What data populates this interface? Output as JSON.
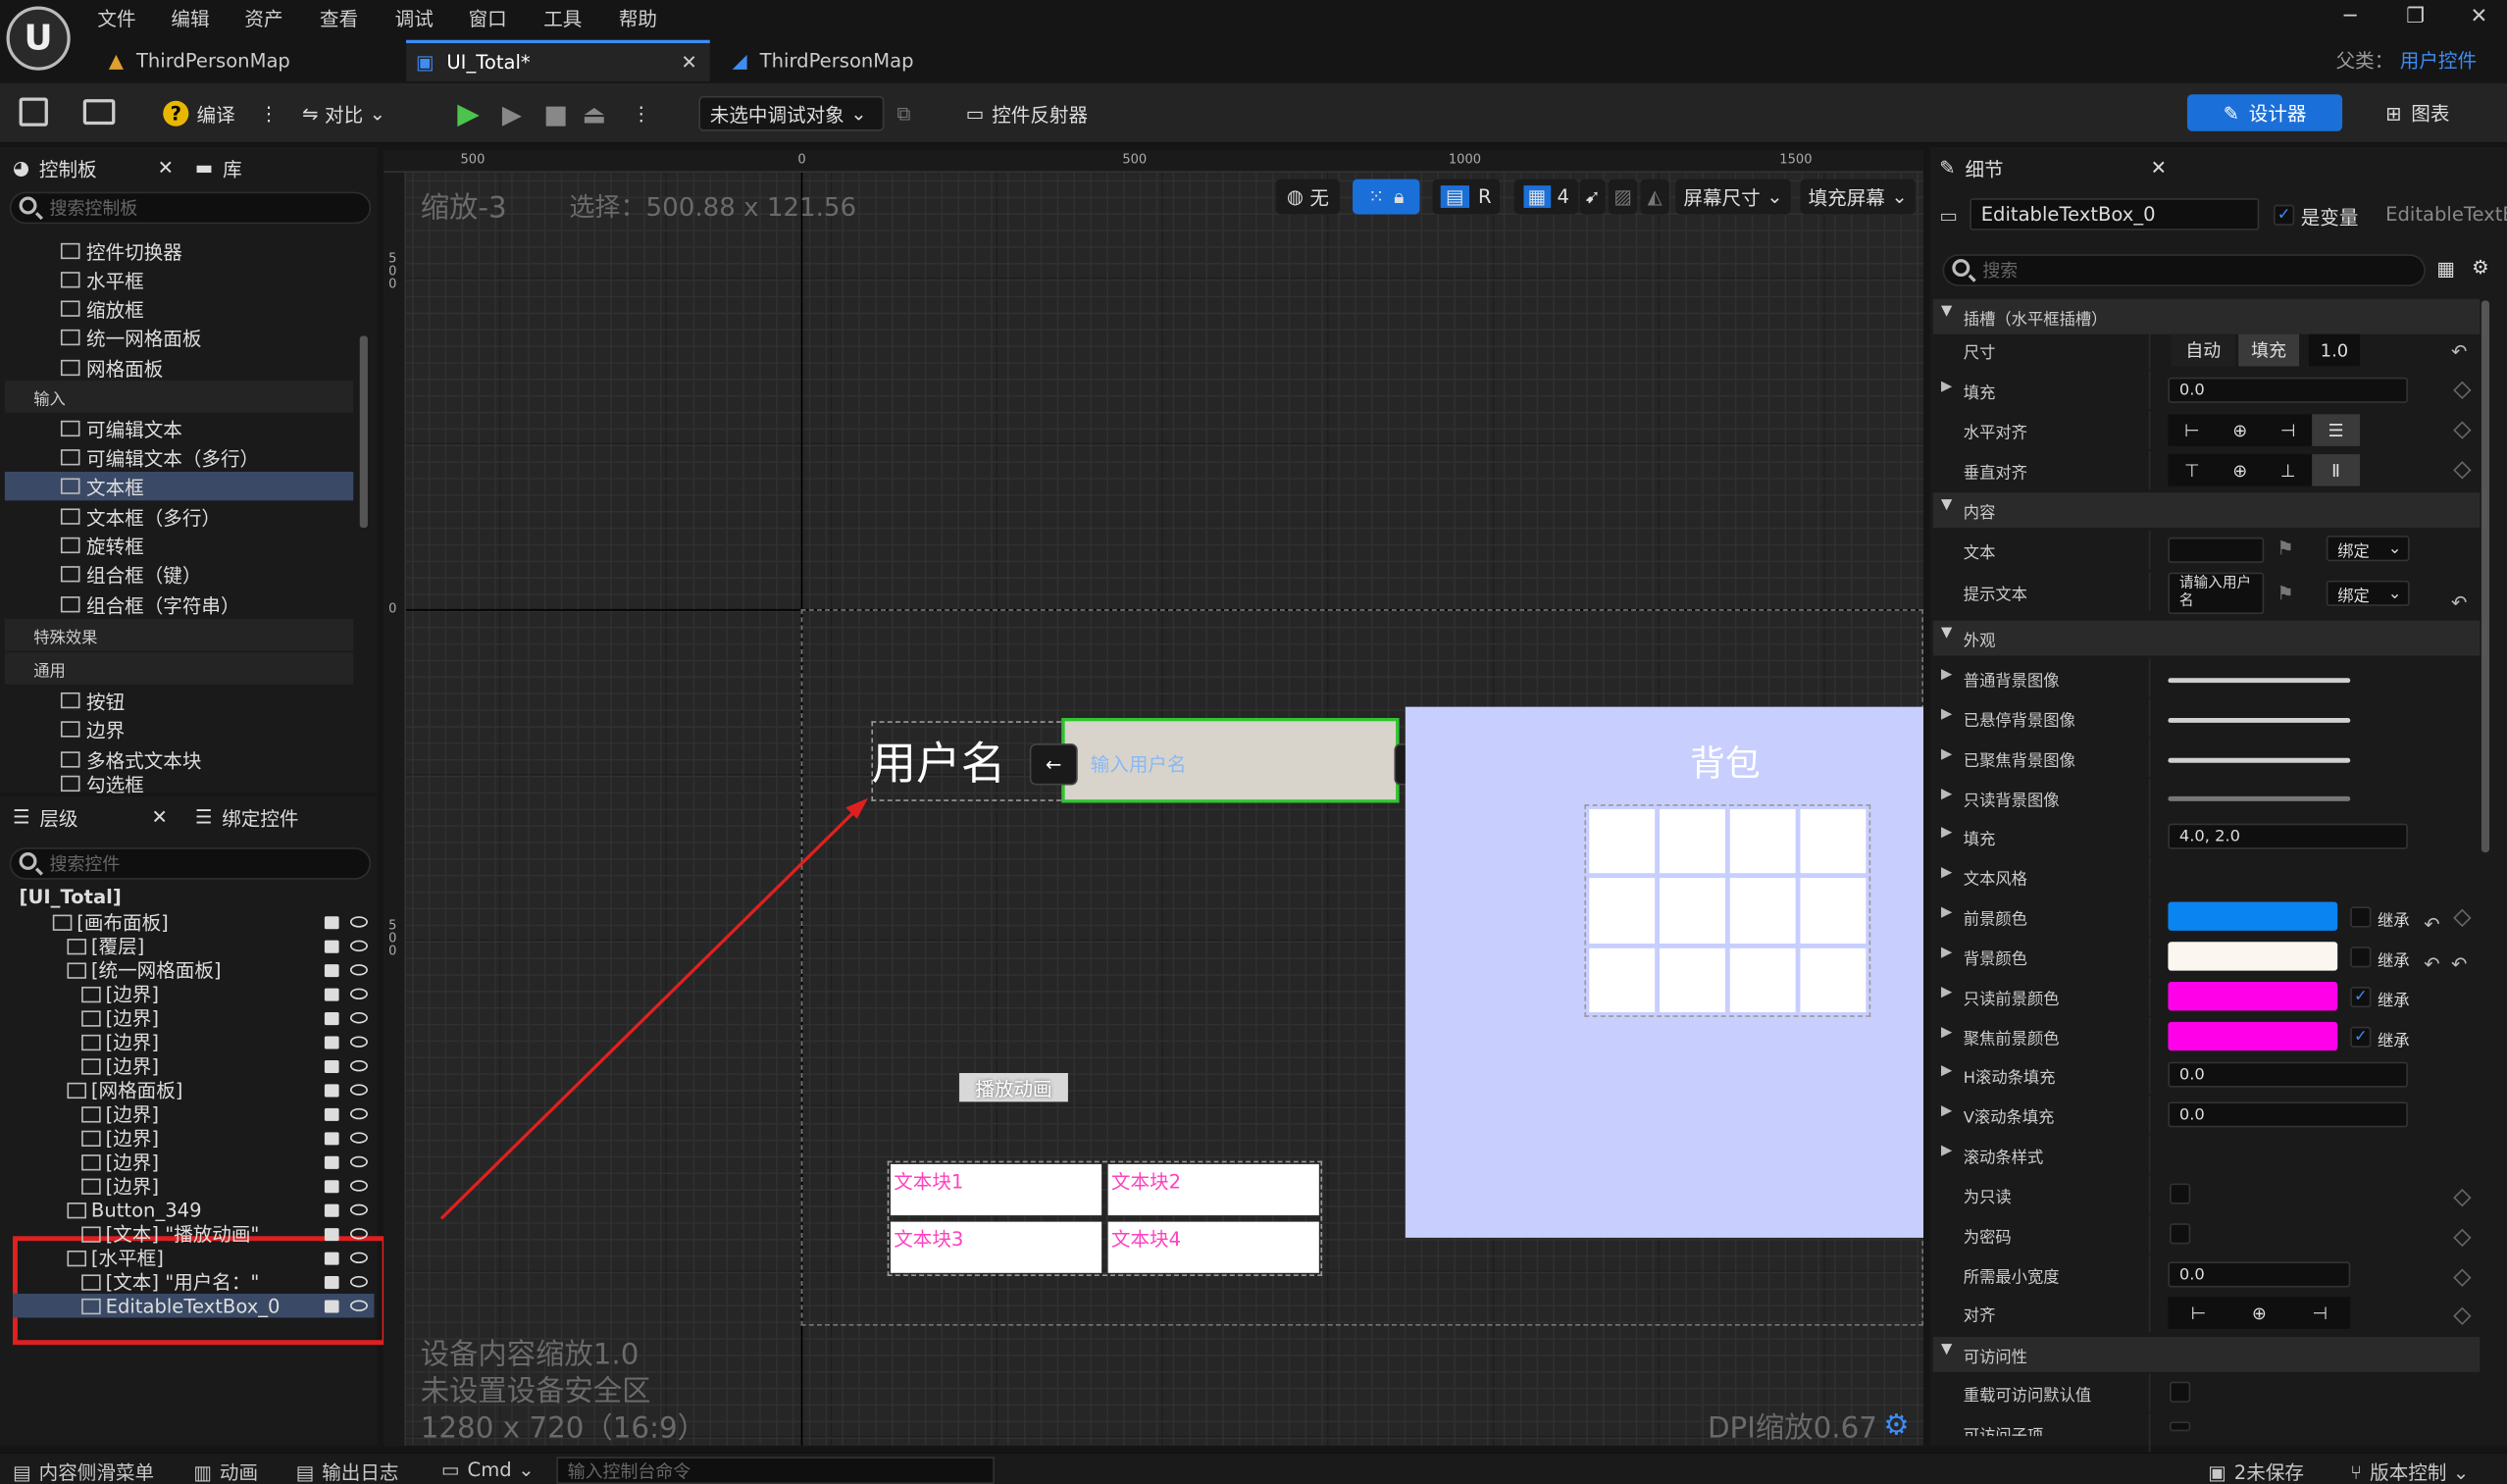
{
  "menubar": {
    "items": [
      "文件",
      "编辑",
      "资产",
      "查看",
      "调试",
      "窗口",
      "工具",
      "帮助"
    ],
    "logo": "U"
  },
  "tabs": [
    {
      "label": "ThirdPersonMap"
    },
    {
      "label": "UI_Total*"
    },
    {
      "label": "ThirdPersonMap"
    }
  ],
  "parent_class": {
    "label": "父类：",
    "value": "用户控件"
  },
  "toolbar": {
    "compile": "编译",
    "diff": "对比",
    "debug_target": "未选中调试对象",
    "widget_reflector": "控件反射器",
    "designer": "设计器",
    "graph": "图表"
  },
  "palette": {
    "tab": "控制板",
    "lib_tab": "库",
    "search_placeholder": "搜索控制板",
    "items_top": [
      "控件切换器",
      "水平框",
      "缩放框",
      "统一网格面板",
      "网格面板"
    ],
    "cat_input": "输入",
    "input_items": [
      "可编辑文本",
      "可编辑文本（多行）",
      "文本框",
      "文本框（多行）",
      "旋转框",
      "组合框（键）",
      "组合框（字符串）"
    ],
    "cat_effects": "特殊效果",
    "cat_common": "通用",
    "common_items": [
      "按钮",
      "边界",
      "多格式文本块",
      "勾选框"
    ]
  },
  "hierarchy": {
    "tab": "层级",
    "bind_tab": "绑定控件",
    "search_placeholder": "搜索控件",
    "root": "[UI_Total]",
    "items": [
      "[画布面板]",
      "[覆层]",
      "[统一网格面板]",
      "[边界]",
      "[边界]",
      "[边界]",
      "[边界]",
      "[网格面板]",
      "[边界]",
      "[边界]",
      "[边界]",
      "[边界]",
      "Button_349",
      "[文本] \"播放动画\"",
      "[水平框]",
      "[文本] \"用户名：\"",
      "EditableTextBox_0"
    ]
  },
  "viewport": {
    "zoom": "缩放-3",
    "selection": "选择：500.88 x 121.56",
    "rulers_top": [
      "500",
      "0",
      "500",
      "1000",
      "1500"
    ],
    "rulers_left": [
      "500",
      "0",
      "500"
    ],
    "btn_none": "无",
    "btn_r": "R",
    "btn_4": "4",
    "screen_size": "屏幕尺寸",
    "fill_screen": "填充屏幕",
    "username_label": "用户名",
    "username_placeholder": "输入用户名",
    "arrow_left": "←",
    "arrow_right": "→",
    "backpack": "背包",
    "play_anim": "播放动画",
    "text_blocks": [
      "文本块1",
      "文本块2",
      "文本块3",
      "文本块4"
    ],
    "device_scale": "设备内容缩放1.0",
    "safe_zone": "未设置设备安全区",
    "resolution": "1280 x 720（16:9）",
    "dpi": "DPI缩放0.67"
  },
  "details": {
    "tab": "细节",
    "name": "EditableTextBox_0",
    "is_variable": "是变量",
    "class_label": "EditableTextB",
    "search_placeholder": "搜索",
    "sec_slot": "插槽（水平框插槽）",
    "size_label": "尺寸",
    "size_auto": "自动",
    "size_fill": "填充",
    "size_value": "1.0",
    "padding_label": "填充",
    "padding_value": "0.0",
    "halign_label": "水平对齐",
    "valign_label": "垂直对齐",
    "sec_content": "内容",
    "text_label": "文本",
    "bind": "绑定",
    "hint_label": "提示文本",
    "hint_value": "请输入用户名",
    "sec_appearance": "外观",
    "normal_bg": "普通背景图像",
    "hover_bg": "已悬停背景图像",
    "focus_bg": "已聚焦背景图像",
    "readonly_bg": "只读背景图像",
    "fill_label": "填充",
    "fill_value": "4.0, 2.0",
    "text_style": "文本风格",
    "fg_color": "前景颜色",
    "bg_color": "背景颜色",
    "ro_fg_color": "只读前景颜色",
    "focus_fg_color": "聚焦前景颜色",
    "inherit": "继承",
    "h_scroll_pad": "H滚动条填充",
    "h_scroll_val": "0.0",
    "v_scroll_pad": "V滚动条填充",
    "v_scroll_val": "0.0",
    "scroll_style": "滚动条样式",
    "readonly": "为只读",
    "password": "为密码",
    "min_width": "所需最小宽度",
    "min_width_val": "0.0",
    "justify": "对齐",
    "sec_access": "可访问性",
    "override_access": "重载可访问默认值",
    "access_child": "可访问子项",
    "colors": {
      "fg": "#0a84f0",
      "bg": "#fbf6ef",
      "ro_fg": "#ff00e8",
      "focus_fg": "#ff00e8"
    }
  },
  "statusbar": {
    "content_drawer": "内容侧滑菜单",
    "anim": "动画",
    "output_log": "输出日志",
    "cmd": "Cmd",
    "cmd_placeholder": "输入控制台命令",
    "unsaved": "2未保存",
    "version_control": "版本控制"
  },
  "colors": {
    "accent": "#3d8df5",
    "selection_red": "#e02020",
    "canvas_panel": "#c8cfff"
  }
}
